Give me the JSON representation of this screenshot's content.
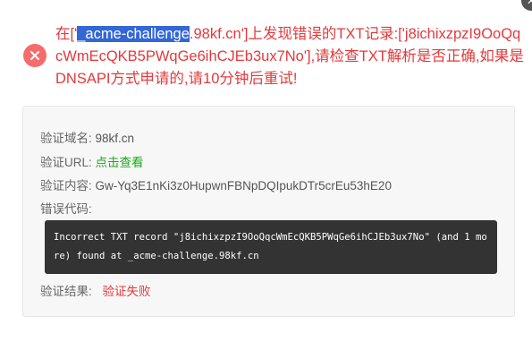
{
  "error": {
    "icon": "close-circle-icon",
    "prefix": "在['",
    "highlighted": "_acme-challenge",
    "rest": ".98kf.cn']上发现错误的TXT记录:['j8ichixzpzI9OoQqcWmEcQKB5PWqGe6ihCJEb3ux7No'],请检查TXT解析是否正确,如果是DNSAPI方式申请的,请10分钟后重试!"
  },
  "verification": {
    "domain_label": "验证域名:",
    "domain_value": "98kf.cn",
    "url_label": "验证URL:",
    "url_link": "点击查看",
    "content_label": "验证内容:",
    "content_value": "Gw-Yq3E1nKi3z0HupwnFBNpDQIpukDTr5crEu53hE20",
    "error_code_label": "错误代码:",
    "error_code_text": "Incorrect TXT record \"j8ichixzpzI9OoQqcWmEcQKB5PWqGe6ihCJEb3ux7No\" (and 1 more) found at _acme-challenge.98kf.cn",
    "result_label": "验证结果:",
    "result_value": "验证失败"
  },
  "colors": {
    "error_red": "#e4393c",
    "icon_red": "#f56c6c",
    "link_green": "#1aad19",
    "highlight": "#3367d6",
    "code_bg": "#333333"
  }
}
